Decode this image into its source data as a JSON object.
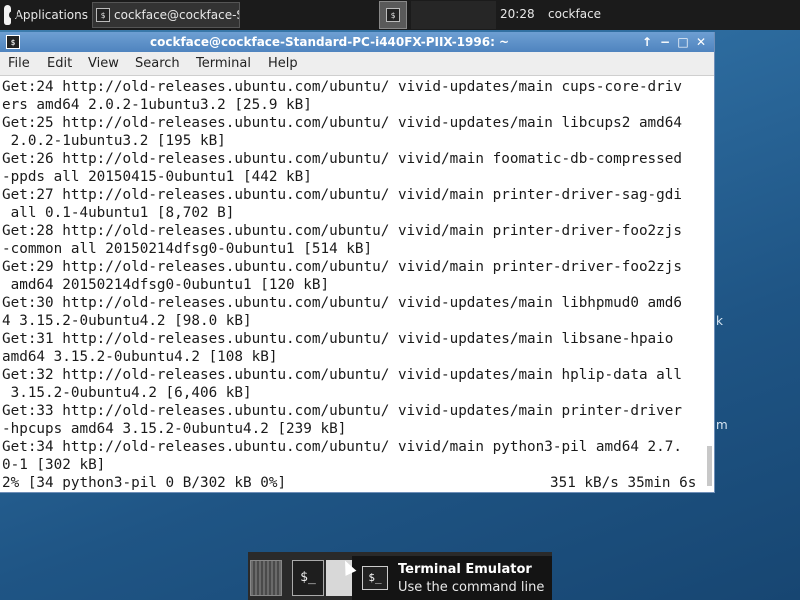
{
  "panel": {
    "applications_label": "Applications",
    "task_label": "cockface@cockface-Sta...",
    "clock": "20:28",
    "user": "cockface"
  },
  "window": {
    "title": "cockface@cockface-Standard-PC-i440FX-PIIX-1996: ~",
    "controls": {
      "up": "↑",
      "min": "−",
      "max": "□",
      "close": "✕"
    }
  },
  "menu": [
    "File",
    "Edit",
    "View",
    "Search",
    "Terminal",
    "Help"
  ],
  "terminal": {
    "lines": [
      "Get:24 http://old-releases.ubuntu.com/ubuntu/ vivid-updates/main cups-core-driv",
      "ers amd64 2.0.2-1ubuntu3.2 [25.9 kB]",
      "Get:25 http://old-releases.ubuntu.com/ubuntu/ vivid-updates/main libcups2 amd64",
      " 2.0.2-1ubuntu3.2 [195 kB]",
      "Get:26 http://old-releases.ubuntu.com/ubuntu/ vivid/main foomatic-db-compressed",
      "-ppds all 20150415-0ubuntu1 [442 kB]",
      "Get:27 http://old-releases.ubuntu.com/ubuntu/ vivid/main printer-driver-sag-gdi",
      " all 0.1-4ubuntu1 [8,702 B]",
      "Get:28 http://old-releases.ubuntu.com/ubuntu/ vivid/main printer-driver-foo2zjs",
      "-common all 20150214dfsg0-0ubuntu1 [514 kB]",
      "Get:29 http://old-releases.ubuntu.com/ubuntu/ vivid/main printer-driver-foo2zjs",
      " amd64 20150214dfsg0-0ubuntu1 [120 kB]",
      "Get:30 http://old-releases.ubuntu.com/ubuntu/ vivid-updates/main libhpmud0 amd6",
      "4 3.15.2-0ubuntu4.2 [98.0 kB]",
      "Get:31 http://old-releases.ubuntu.com/ubuntu/ vivid-updates/main libsane-hpaio",
      "amd64 3.15.2-0ubuntu4.2 [108 kB]",
      "Get:32 http://old-releases.ubuntu.com/ubuntu/ vivid-updates/main hplip-data all",
      " 3.15.2-0ubuntu4.2 [6,406 kB]",
      "Get:33 http://old-releases.ubuntu.com/ubuntu/ vivid-updates/main printer-driver",
      "-hpcups amd64 3.15.2-0ubuntu4.2 [239 kB]",
      "Get:34 http://old-releases.ubuntu.com/ubuntu/ vivid/main python3-pil amd64 2.7.",
      "0-1 [302 kB]"
    ],
    "status_left": "2% [34 python3-pil 0 B/302 kB 0%]",
    "status_right": "351 kB/s 35min 6s"
  },
  "desktop_fragments": {
    "frag1": "k",
    "frag2": "m"
  },
  "tooltip": {
    "title": "Terminal Emulator",
    "subtitle": "Use the command line"
  },
  "dock": {
    "terminal_glyph": "$_"
  }
}
